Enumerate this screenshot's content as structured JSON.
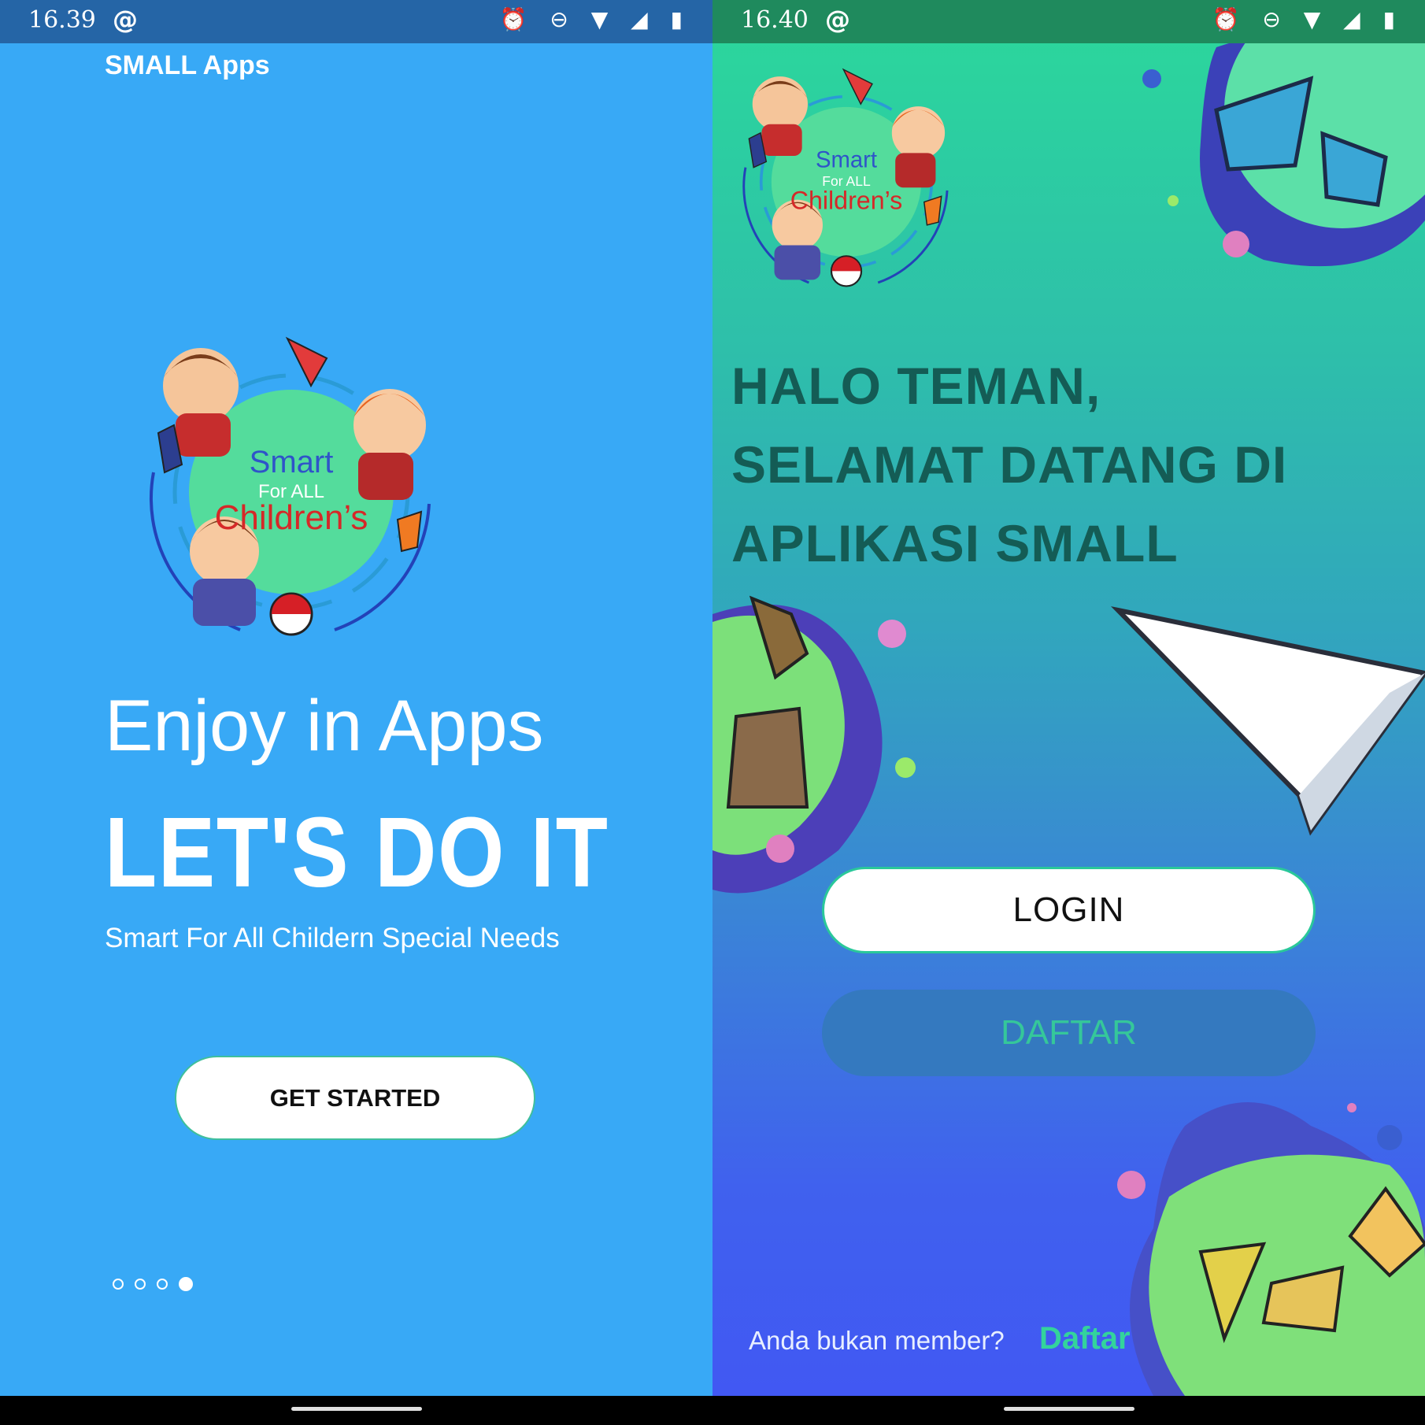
{
  "left": {
    "status": {
      "time": "16.39",
      "at_icon": "@",
      "icons": "⏰ ⊖ ▼ ◢ ▮"
    },
    "app_title": "SMALL Apps",
    "logo": {
      "line1": "Smart",
      "line2": "For ALL",
      "line3": "Children’s"
    },
    "headline_light": "Enjoy in Apps",
    "headline_bold": "LET'S DO IT",
    "tagline": "Smart For All Childern Special Needs",
    "cta": "GET STARTED",
    "pager": {
      "count": 4,
      "active": 4
    }
  },
  "right": {
    "status": {
      "time": "16.40",
      "at_icon": "@",
      "icons": "⏰ ⊖ ▼ ◢ ▮"
    },
    "logo": {
      "line1": "Smart",
      "line2": "For ALL",
      "line3": "Children’s"
    },
    "greeting_lines": [
      "HALO TEMAN,",
      "SELAMAT DATANG DI",
      "APLIKASI SMALL"
    ],
    "login_label": "LOGIN",
    "register_label": "DAFTAR",
    "member_question": "Anda bukan member?",
    "member_link": "Daftar"
  },
  "colors": {
    "left_bg": "#38a9f6",
    "left_statusbar": "#2565a6",
    "right_statusbar": "#1f8a5d",
    "greeting_text": "#145c55",
    "accent_green": "#33d39c"
  }
}
